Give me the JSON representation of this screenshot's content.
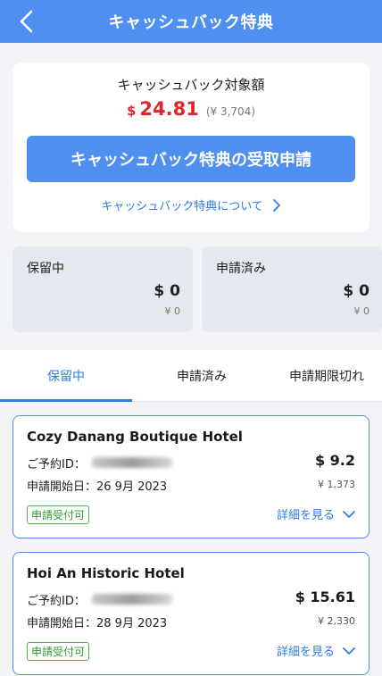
{
  "header": {
    "title": "キャッシュバック特典"
  },
  "summary": {
    "label": "キャッシュバック対象額",
    "currency_symbol": "$",
    "amount": "24.81",
    "yen_amount": "(¥ 3,704)",
    "claim_button": "キャッシュバック特典の受取申請",
    "about_link": "キャッシュバック特典について"
  },
  "stats": [
    {
      "label": "保留中",
      "usd": "$ 0",
      "jpy": "¥ 0"
    },
    {
      "label": "申請済み",
      "usd": "$ 0",
      "jpy": "¥ 0"
    }
  ],
  "tabs": [
    {
      "label": "保留中",
      "active": true
    },
    {
      "label": "申請済み",
      "active": false
    },
    {
      "label": "申請期限切れ",
      "active": false
    }
  ],
  "bookings": [
    {
      "hotel": "Cozy Danang Boutique Hotel",
      "booking_id_label": "ご予約ID：",
      "date_text": "申請開始日：26 9月 2023",
      "usd": "$ 9.2",
      "jpy": "¥ 1,373",
      "status": "申請受付可",
      "details": "詳細を見る"
    },
    {
      "hotel": "Hoi An Historic Hotel",
      "booking_id_label": "ご予約ID：",
      "date_text": "申請開始日：28 9月 2023",
      "usd": "$ 15.61",
      "jpy": "¥ 2,330",
      "status": "申請受付可",
      "details": "詳細を見る"
    }
  ],
  "colors": {
    "brand_blue": "#4f8ff0",
    "link_blue": "#2f7ae5",
    "amount_red": "#e0252d",
    "status_green": "#2e9a2e"
  },
  "icons": [
    "back-arrow-icon",
    "chevron-right-icon",
    "chevron-down-icon"
  ]
}
